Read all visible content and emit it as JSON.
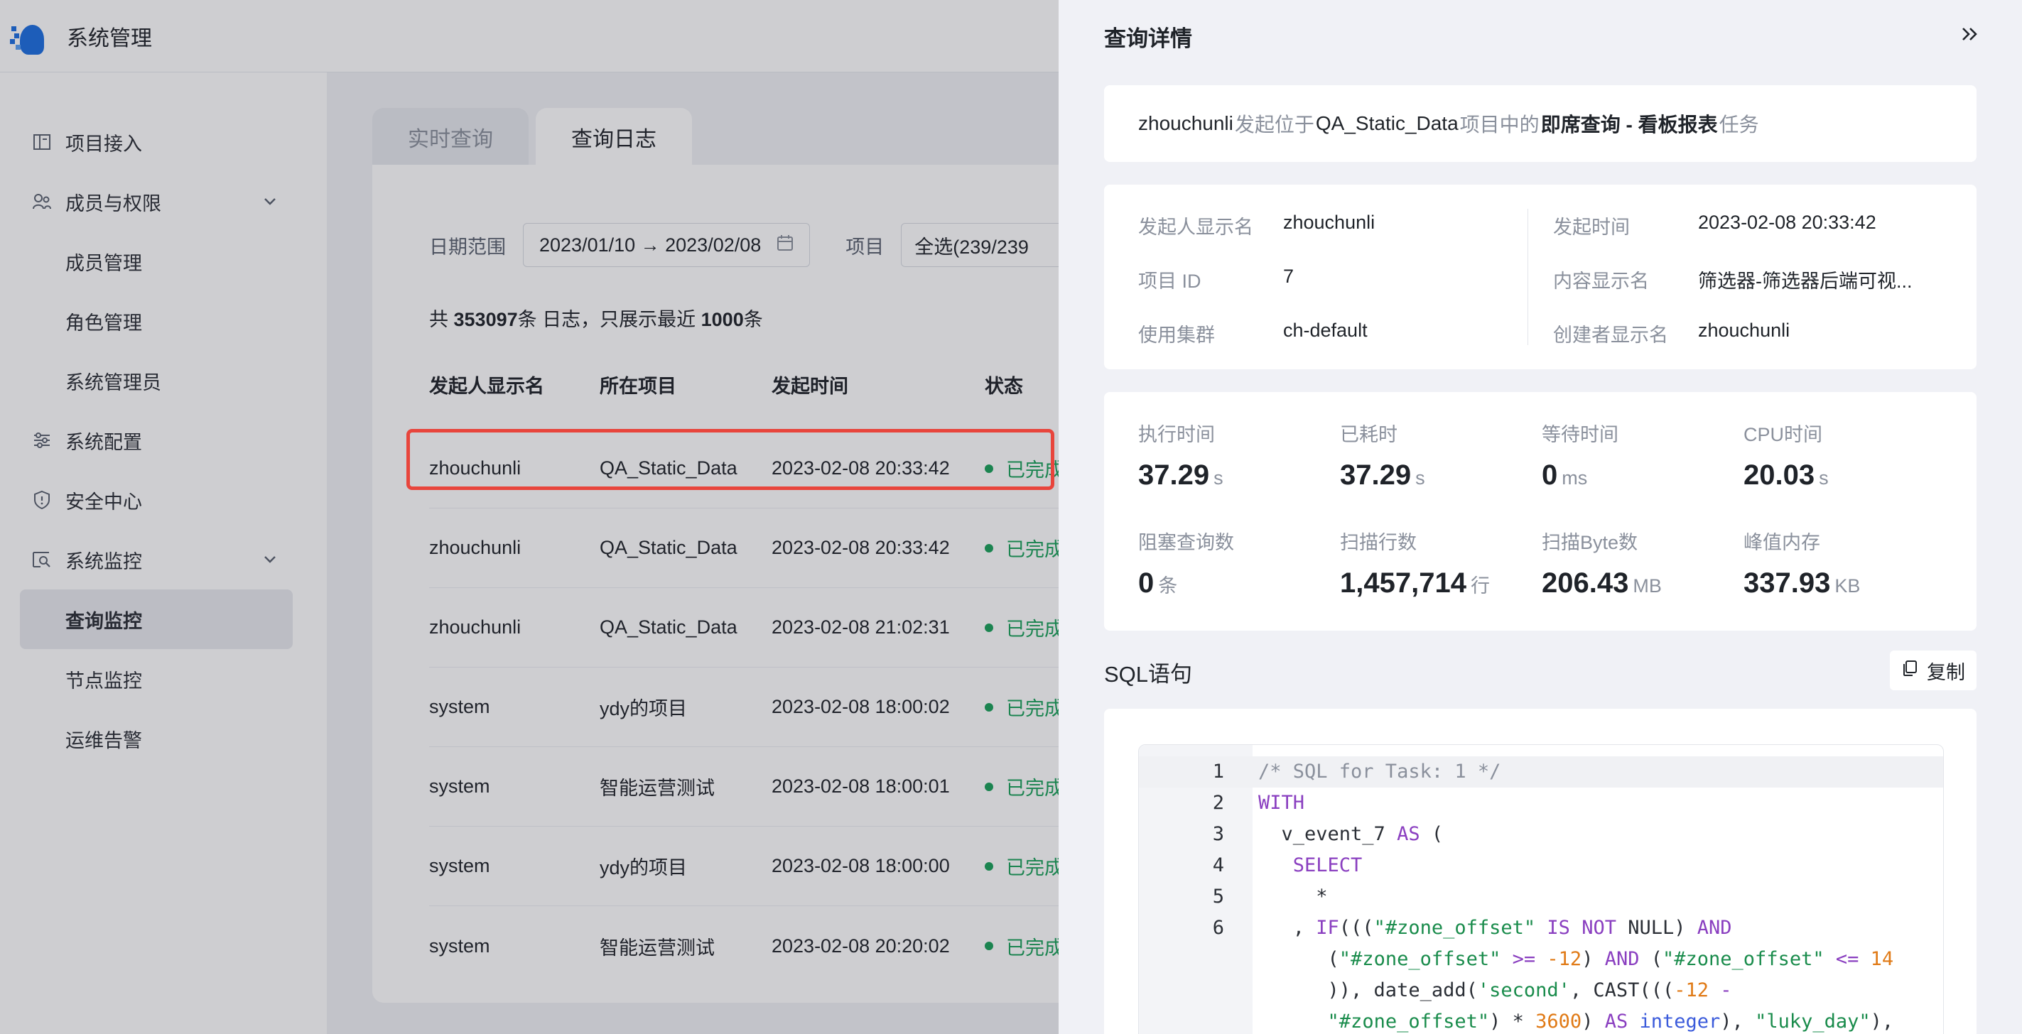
{
  "app": {
    "title": "系统管理"
  },
  "sidebar": {
    "items": [
      {
        "label": "项目接入",
        "icon": "book-icon"
      },
      {
        "label": "成员与权限",
        "icon": "users-icon",
        "expandable": true
      },
      {
        "label": "成员管理",
        "sub": true
      },
      {
        "label": "角色管理",
        "sub": true
      },
      {
        "label": "系统管理员",
        "sub": true
      },
      {
        "label": "系统配置",
        "icon": "sliders-icon"
      },
      {
        "label": "安全中心",
        "icon": "shield-icon"
      },
      {
        "label": "系统监控",
        "icon": "monitor-icon",
        "expandable": true
      },
      {
        "label": "查询监控",
        "sub": true,
        "active": true
      },
      {
        "label": "节点监控",
        "sub": true
      },
      {
        "label": "运维告警",
        "sub": true
      }
    ]
  },
  "main": {
    "tabs": [
      {
        "label": "实时查询"
      },
      {
        "label": "查询日志",
        "active": true
      }
    ],
    "filters": {
      "date_label": "日期范围",
      "date_value": "2023/01/10 → 2023/02/08",
      "project_label": "项目",
      "project_value": "全选(239/239"
    },
    "summary": {
      "prefix": "共 ",
      "total": "353097",
      "mid": "条 日志，只展示最近 ",
      "recent": "1000",
      "suffix": "条"
    },
    "table": {
      "headers": [
        "发起人显示名",
        "所在项目",
        "发起时间",
        "状态"
      ],
      "rows": [
        {
          "user": "zhouchunli",
          "project": "QA_Static_Data",
          "time": "2023-02-08 20:33:42",
          "status": "已完成"
        },
        {
          "user": "zhouchunli",
          "project": "QA_Static_Data",
          "time": "2023-02-08 20:33:42",
          "status": "已完成"
        },
        {
          "user": "zhouchunli",
          "project": "QA_Static_Data",
          "time": "2023-02-08 21:02:31",
          "status": "已完成"
        },
        {
          "user": "system",
          "project": "ydy的项目",
          "time": "2023-02-08 18:00:02",
          "status": "已完成"
        },
        {
          "user": "system",
          "project": "智能运营测试",
          "time": "2023-02-08 18:00:01",
          "status": "已完成"
        },
        {
          "user": "system",
          "project": "ydy的项目",
          "time": "2023-02-08 18:00:00",
          "status": "已完成"
        },
        {
          "user": "system",
          "project": "智能运营测试",
          "time": "2023-02-08 20:20:02",
          "status": "已完成"
        }
      ]
    }
  },
  "drawer": {
    "title": "查询详情",
    "close_icon": "double-chevron-right-icon",
    "info": {
      "user": "zhouchunli",
      "t1": "发起位于",
      "project": "QA_Static_Data",
      "t2": "项目中的",
      "task": "即席查询 - 看板报表",
      "t3": "任务"
    },
    "meta": {
      "left": [
        {
          "label": "发起人显示名",
          "value": "zhouchunli"
        },
        {
          "label": "项目 ID",
          "value": "7"
        },
        {
          "label": "使用集群",
          "value": "ch-default"
        }
      ],
      "right": [
        {
          "label": "发起时间",
          "value": "2023-02-08 20:33:42"
        },
        {
          "label": "内容显示名",
          "value": "筛选器-筛选器后端可视..."
        },
        {
          "label": "创建者显示名",
          "value": "zhouchunli"
        }
      ]
    },
    "stats": [
      {
        "label": "执行时间",
        "value": "37.29",
        "unit": "s"
      },
      {
        "label": "已耗时",
        "value": "37.29",
        "unit": "s"
      },
      {
        "label": "等待时间",
        "value": "0",
        "unit": "ms"
      },
      {
        "label": "CPU时间",
        "value": "20.03",
        "unit": "s"
      },
      {
        "label": "阻塞查询数",
        "value": "0",
        "unit": "条"
      },
      {
        "label": "扫描行数",
        "value": "1,457,714",
        "unit": "行"
      },
      {
        "label": "扫描Byte数",
        "value": "206.43",
        "unit": "MB"
      },
      {
        "label": "峰值内存",
        "value": "337.93",
        "unit": "KB"
      }
    ],
    "sql": {
      "title": "SQL语句",
      "copy_label": "复制",
      "line_numbers": [
        "1",
        "2",
        "3",
        "4",
        "5",
        "6"
      ]
    }
  }
}
